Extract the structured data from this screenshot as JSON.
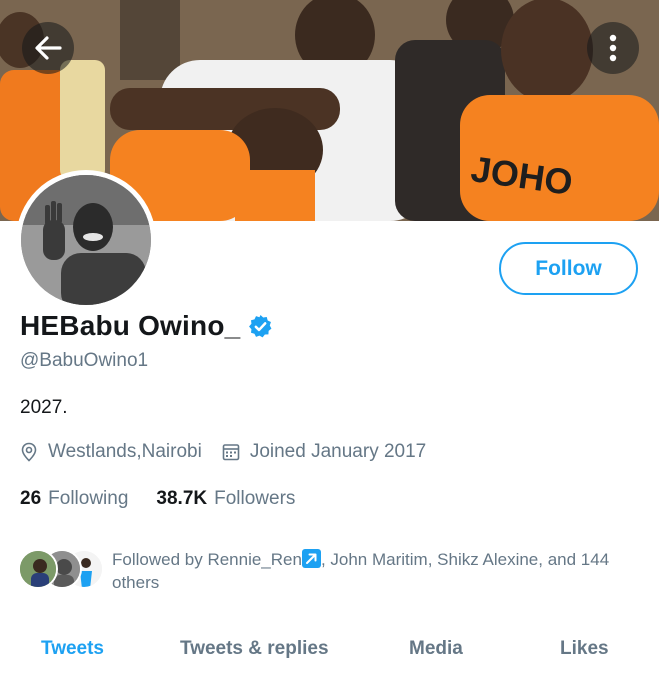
{
  "profile": {
    "display_name": "HEBabu Owino_",
    "handle": "@BabuOwino1",
    "bio": "2027.",
    "location": "Westlands,Nairobi",
    "joined": "Joined January 2017",
    "verified_icon": "verified-badge-icon"
  },
  "actions": {
    "follow_label": "Follow"
  },
  "stats": {
    "following_count": "26",
    "following_label": "Following",
    "followers_count": "38.7K",
    "followers_label": "Followers"
  },
  "followed_by": {
    "prefix": "Followed by ",
    "first": "Rennie_Ren",
    "rest": ", John Maritim, Shikz Alexine, and 144 others"
  },
  "tabs": [
    {
      "label": "Tweets",
      "active": true
    },
    {
      "label": "Tweets & replies",
      "active": false
    },
    {
      "label": "Media",
      "active": false
    },
    {
      "label": "Likes",
      "active": false
    }
  ],
  "colors": {
    "accent": "#1da1f2",
    "text_primary": "#14171a",
    "text_secondary": "#657786",
    "shirt_orange": "#f58220"
  },
  "banner_text": "JOHO"
}
